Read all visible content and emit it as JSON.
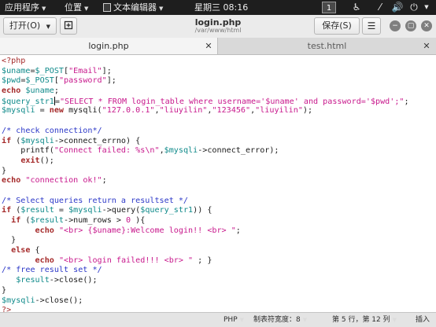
{
  "topbar": {
    "apps_menu": "应用程序",
    "places_menu": "位置",
    "editor_menu": "文本编辑器",
    "clock": "星期三 08:16",
    "workspace": "1"
  },
  "header": {
    "open_label": "打开(O)",
    "title": "login.php",
    "subtitle": "/var/www/html",
    "save_label": "保存(S)"
  },
  "tabs": [
    {
      "label": "login.php",
      "active": true
    },
    {
      "label": "test.html",
      "active": false
    }
  ],
  "code_lines": [
    [
      [
        "php",
        "<?php"
      ]
    ],
    [
      [
        "var",
        "$uname"
      ],
      [
        "txt",
        "="
      ],
      [
        "var",
        "$_POST"
      ],
      [
        "txt",
        "["
      ],
      [
        "str",
        "\"Email\""
      ],
      [
        "txt",
        "];"
      ]
    ],
    [
      [
        "var",
        "$pwd"
      ],
      [
        "txt",
        "="
      ],
      [
        "var",
        "$_POST"
      ],
      [
        "txt",
        "["
      ],
      [
        "str",
        "\"password\""
      ],
      [
        "txt",
        "];"
      ]
    ],
    [
      [
        "kw",
        "echo"
      ],
      [
        "txt",
        " "
      ],
      [
        "var",
        "$uname"
      ],
      [
        "txt",
        ";"
      ]
    ],
    [
      [
        "var",
        "$query_str1"
      ],
      [
        "caret",
        ""
      ],
      [
        "txt",
        "="
      ],
      [
        "str",
        "\"SELECT * FROM login_table where username='$uname' and password='$pwd';\""
      ],
      [
        "txt",
        ";"
      ]
    ],
    [
      [
        "var",
        "$mysqli"
      ],
      [
        "txt",
        " = "
      ],
      [
        "kw",
        "new"
      ],
      [
        "txt",
        " mysqli("
      ],
      [
        "str",
        "\"127.0.0.1\""
      ],
      [
        "txt",
        ","
      ],
      [
        "str",
        "\"liuyilin\""
      ],
      [
        "txt",
        ","
      ],
      [
        "str",
        "\"123456\""
      ],
      [
        "txt",
        ","
      ],
      [
        "str",
        "\"liuyilin\""
      ],
      [
        "txt",
        ");"
      ]
    ],
    [
      [
        "txt",
        ""
      ]
    ],
    [
      [
        "com",
        "/* check connection*/"
      ]
    ],
    [
      [
        "kw",
        "if"
      ],
      [
        "txt",
        " ("
      ],
      [
        "var",
        "$mysqli"
      ],
      [
        "txt",
        "->connect_errno) {"
      ]
    ],
    [
      [
        "txt",
        "    printf("
      ],
      [
        "str",
        "\"Connect failed: %s\\n\""
      ],
      [
        "txt",
        ","
      ],
      [
        "var",
        "$mysqli"
      ],
      [
        "txt",
        "->connect_error);"
      ]
    ],
    [
      [
        "txt",
        "    "
      ],
      [
        "kw",
        "exit"
      ],
      [
        "txt",
        "();"
      ]
    ],
    [
      [
        "txt",
        "}"
      ]
    ],
    [
      [
        "kw",
        "echo"
      ],
      [
        "txt",
        " "
      ],
      [
        "str",
        "\"connection ok!\""
      ],
      [
        "txt",
        ";"
      ]
    ],
    [
      [
        "txt",
        ""
      ]
    ],
    [
      [
        "com",
        "/* Select queries return a resultset */"
      ]
    ],
    [
      [
        "kw",
        "if"
      ],
      [
        "txt",
        " ("
      ],
      [
        "var",
        "$result"
      ],
      [
        "txt",
        " = "
      ],
      [
        "var",
        "$mysqli"
      ],
      [
        "txt",
        "->query("
      ],
      [
        "var",
        "$query_str1"
      ],
      [
        "txt",
        ")) {"
      ]
    ],
    [
      [
        "txt",
        "  "
      ],
      [
        "kw",
        "if"
      ],
      [
        "txt",
        " ("
      ],
      [
        "var",
        "$result"
      ],
      [
        "txt",
        "->num_rows > "
      ],
      [
        "num",
        "0"
      ],
      [
        "txt",
        " ){"
      ]
    ],
    [
      [
        "txt",
        "       "
      ],
      [
        "kw",
        "echo"
      ],
      [
        "txt",
        " "
      ],
      [
        "str",
        "\"<br> {$uname}:Welcome login!! <br> \""
      ],
      [
        "txt",
        ";"
      ]
    ],
    [
      [
        "txt",
        "  }"
      ]
    ],
    [
      [
        "txt",
        "  "
      ],
      [
        "kw",
        "else"
      ],
      [
        "txt",
        " {"
      ]
    ],
    [
      [
        "txt",
        "       "
      ],
      [
        "kw",
        "echo"
      ],
      [
        "txt",
        " "
      ],
      [
        "str",
        "\"<br> login failed!!! <br> \""
      ],
      [
        "txt",
        " ; }"
      ]
    ],
    [
      [
        "com",
        "/* free result set */"
      ]
    ],
    [
      [
        "txt",
        "   "
      ],
      [
        "var",
        "$result"
      ],
      [
        "txt",
        "->close();"
      ]
    ],
    [
      [
        "txt",
        "}"
      ]
    ],
    [
      [
        "var",
        "$mysqli"
      ],
      [
        "txt",
        "->close();"
      ]
    ],
    [
      [
        "php",
        "?>"
      ]
    ]
  ],
  "statusbar": {
    "language": "PHP",
    "tab_width": "制表符宽度：8",
    "position": "第 5 行，第 12 列",
    "insert_mode": "插入"
  },
  "colors": {
    "php_tag": "#a52a2a",
    "variable": "#0f8a8a",
    "string": "#c8188c",
    "keyword": "#a52a2a",
    "comment": "#2d39c8"
  },
  "icons": [
    "new-document-icon",
    "menu-icon",
    "minimize-icon",
    "maximize-icon",
    "close-icon",
    "accessibility-icon",
    "network-icon",
    "volume-icon",
    "power-icon"
  ]
}
